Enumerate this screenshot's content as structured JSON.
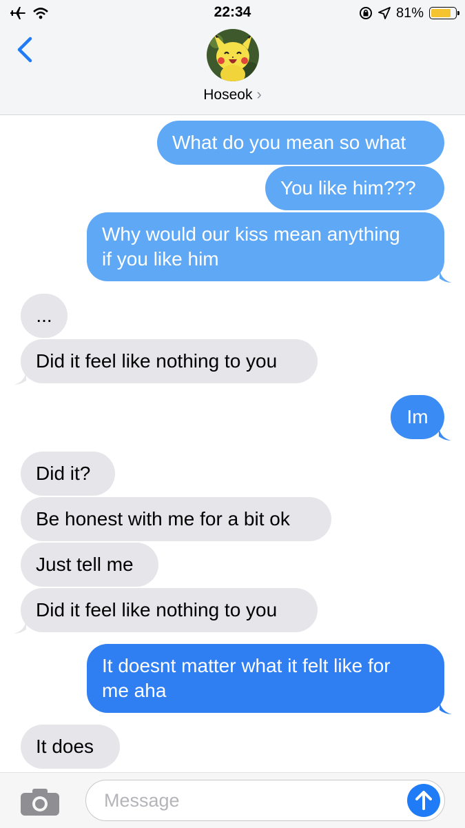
{
  "status_bar": {
    "time": "22:34",
    "battery_percent": "81%",
    "battery_level": 0.81,
    "icons": [
      "airplane-icon",
      "wifi-icon",
      "orientation-lock-icon",
      "location-icon",
      "battery-icon"
    ]
  },
  "header": {
    "back_icon": "chevron-left-icon",
    "contact_name": "Hoseok",
    "contact_chevron": "›",
    "avatar": "pikachu-avatar"
  },
  "colors": {
    "sent_light": "#5ea8f5",
    "sent_dark": "#2f7ff3",
    "received": "#e5e5ea",
    "accent": "#1f7cf6",
    "battery": "#f4c430"
  },
  "messages": [
    {
      "direction": "sent",
      "text": "What do you mean so what"
    },
    {
      "direction": "sent",
      "text": "You like him???"
    },
    {
      "direction": "sent",
      "text": "Why would our kiss mean anything\nif you like him"
    },
    {
      "direction": "received",
      "text": "..."
    },
    {
      "direction": "received",
      "text": "Did it feel like nothing to you"
    },
    {
      "direction": "sent",
      "text": "Im"
    },
    {
      "direction": "received",
      "text": "Did it?"
    },
    {
      "direction": "received",
      "text": "Be honest with me for a bit ok"
    },
    {
      "direction": "received",
      "text": "Just tell me"
    },
    {
      "direction": "received",
      "text": "Did it feel like nothing to you"
    },
    {
      "direction": "sent",
      "text": "It doesnt matter what it felt like for\nme aha"
    },
    {
      "direction": "received",
      "text": "It does"
    }
  ],
  "input_bar": {
    "placeholder": "Message",
    "value": "",
    "camera_icon": "camera-icon",
    "send_icon": "arrow-up-icon"
  }
}
